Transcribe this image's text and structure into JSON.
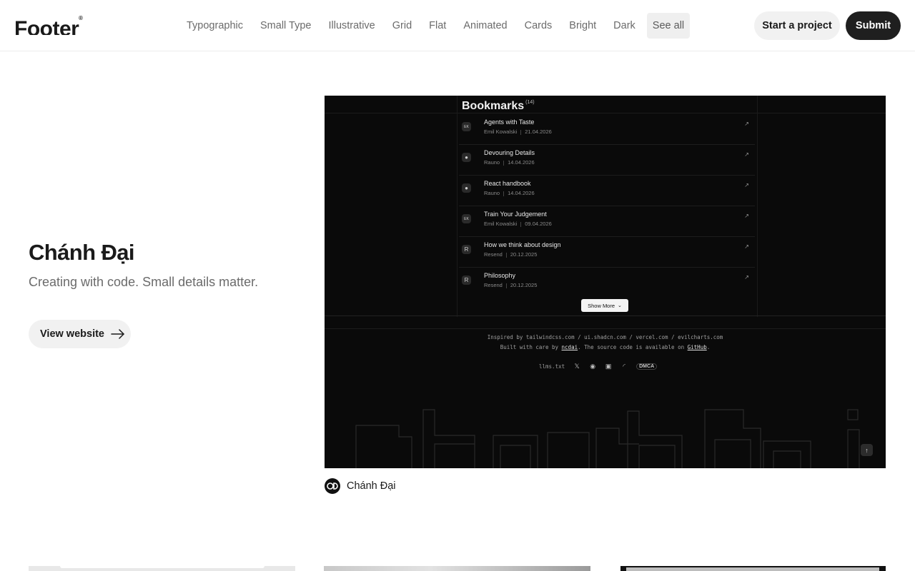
{
  "header": {
    "logo_text": "Footer",
    "logo_mark": "®",
    "nav": [
      "Typographic",
      "Small Type",
      "Illustrative",
      "Grid",
      "Flat",
      "Animated",
      "Cards",
      "Bright",
      "Dark",
      "See all"
    ],
    "start_label": "Start a project",
    "submit_label": "Submit"
  },
  "feature": {
    "title": "Chánh Đại",
    "description": "Creating with code. Small details matter.",
    "view_label": "View website",
    "author": "Chánh Đại",
    "author_initials": "CD"
  },
  "preview": {
    "title": "Bookmarks",
    "count": "(14)",
    "bookmarks": [
      {
        "name": "Agents with Taste",
        "author": "Emil Kowalski",
        "date": "21.04.2026",
        "icon": "EK"
      },
      {
        "name": "Devouring Details",
        "author": "Rauno",
        "date": "14.04.2026",
        "icon": "●"
      },
      {
        "name": "React handbook",
        "author": "Rauno",
        "date": "14.04.2026",
        "icon": "●"
      },
      {
        "name": "Train Your Judgement",
        "author": "Emil Kowalski",
        "date": "09.04.2026",
        "icon": "EK"
      },
      {
        "name": "How we think about design",
        "author": "Resend",
        "date": "20.12.2025",
        "icon": "R"
      },
      {
        "name": "Philosophy",
        "author": "Resend",
        "date": "20.12.2025",
        "icon": "R"
      }
    ],
    "show_more": "Show More",
    "inspired": "Inspired by tailwindcss.com / ui.shadcn.com / vercel.com / evilcharts.com",
    "built_prefix": "Built with care by ",
    "built_author": "ncdai",
    "built_mid": ". The source code is available on ",
    "built_repo": "GitHub",
    "built_suffix": ".",
    "llms": "llms.txt",
    "dmca": "DMCA"
  },
  "colors": {
    "accent_dark": "#1f1f1f",
    "button_light": "#f1f1f1",
    "preview_bg": "#0a0a0a"
  }
}
